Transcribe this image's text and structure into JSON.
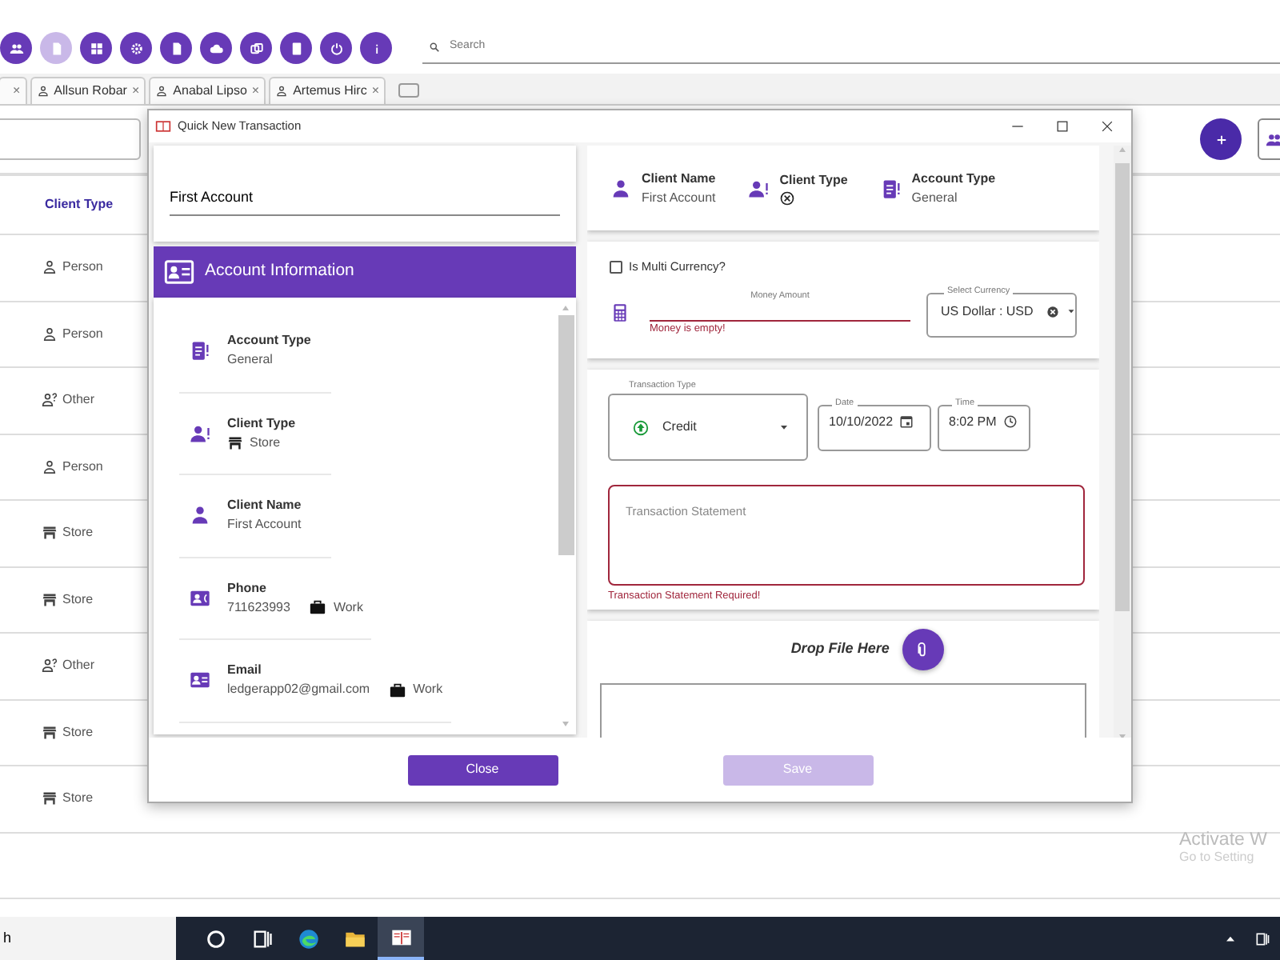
{
  "toolbar": {
    "buttons": [
      {
        "disabled": false
      },
      {
        "disabled": true
      },
      {
        "disabled": false
      },
      {
        "disabled": false
      },
      {
        "disabled": false
      },
      {
        "disabled": false
      },
      {
        "disabled": false
      },
      {
        "disabled": false
      },
      {
        "disabled": false
      },
      {
        "disabled": false
      }
    ]
  },
  "search": {
    "placeholder": "Search"
  },
  "tabs": [
    {
      "close": "×"
    },
    {
      "label": "Allsun Robar",
      "close": "×"
    },
    {
      "label": "Anabal Lipso",
      "close": "×"
    },
    {
      "label": "Artemus Hirc",
      "close": "×"
    }
  ],
  "table": {
    "columns": [
      "Client Type"
    ],
    "rows": [
      {
        "client_type": "Person",
        "kind": "person"
      },
      {
        "client_type": "Person",
        "kind": "person"
      },
      {
        "client_type": "Other",
        "kind": "other"
      },
      {
        "client_type": "Person",
        "kind": "person"
      },
      {
        "client_type": "Store",
        "kind": "store"
      },
      {
        "client_type": "Store",
        "kind": "store"
      },
      {
        "client_type": "Other",
        "kind": "other"
      },
      {
        "client_type": "Store",
        "kind": "store"
      },
      {
        "client_type": "Store",
        "kind": "store"
      }
    ]
  },
  "dialog": {
    "title": "Quick New Transaction",
    "account_field": {
      "value": "First Account"
    },
    "account_info": {
      "title": "Account Information",
      "items": [
        {
          "kind": "account_type",
          "label": "Account Type",
          "value": "General"
        },
        {
          "kind": "client_type",
          "label": "Client Type",
          "value": {
            "kind": "store",
            "text": "Store"
          }
        },
        {
          "kind": "client_name",
          "label": "Client Name",
          "value": "First Account"
        },
        {
          "kind": "phone",
          "label": "Phone",
          "value": "711623993",
          "tag": "Work"
        },
        {
          "kind": "email",
          "label": "Email",
          "value": "ledgerapp02@gmail.com",
          "tag": "Work"
        }
      ]
    },
    "summary": [
      {
        "kind": "client_name",
        "label": "Client Name",
        "value": "First Account"
      },
      {
        "kind": "client_type",
        "label": "Client Type",
        "value": {
          "kind": "none"
        }
      },
      {
        "kind": "account_type",
        "label": "Account Type",
        "value": "General"
      }
    ],
    "multi_currency": {
      "label": "Is Multi Currency?",
      "checked": false
    },
    "money": {
      "label": "Money Amount",
      "error": "Money is empty!"
    },
    "currency": {
      "label": "Select Currency",
      "value": "US Dollar : USD"
    },
    "transaction_type": {
      "label": "Transaction Type",
      "value": "Credit",
      "kind": "credit"
    },
    "date": {
      "label": "Date",
      "value": "10/10/2022"
    },
    "time": {
      "label": "Time",
      "value": "8:02 PM"
    },
    "statement": {
      "placeholder": "Transaction Statement",
      "error": "Transaction Statement Required!"
    },
    "drop": {
      "label": "Drop File Here"
    },
    "buttons": [
      {
        "label": "Close",
        "disabled": false
      },
      {
        "label": "Save",
        "disabled": true
      }
    ]
  },
  "taskbar": {
    "search_text": "h",
    "items": [
      {
        "kind": "circle",
        "selected": false
      },
      {
        "kind": "task_view",
        "selected": false
      },
      {
        "kind": "browser",
        "selected": false
      },
      {
        "kind": "folder",
        "selected": false
      },
      {
        "kind": "book",
        "selected": true
      }
    ]
  },
  "activation": {
    "title": "Activate W",
    "subtitle": "Go to Setting"
  }
}
